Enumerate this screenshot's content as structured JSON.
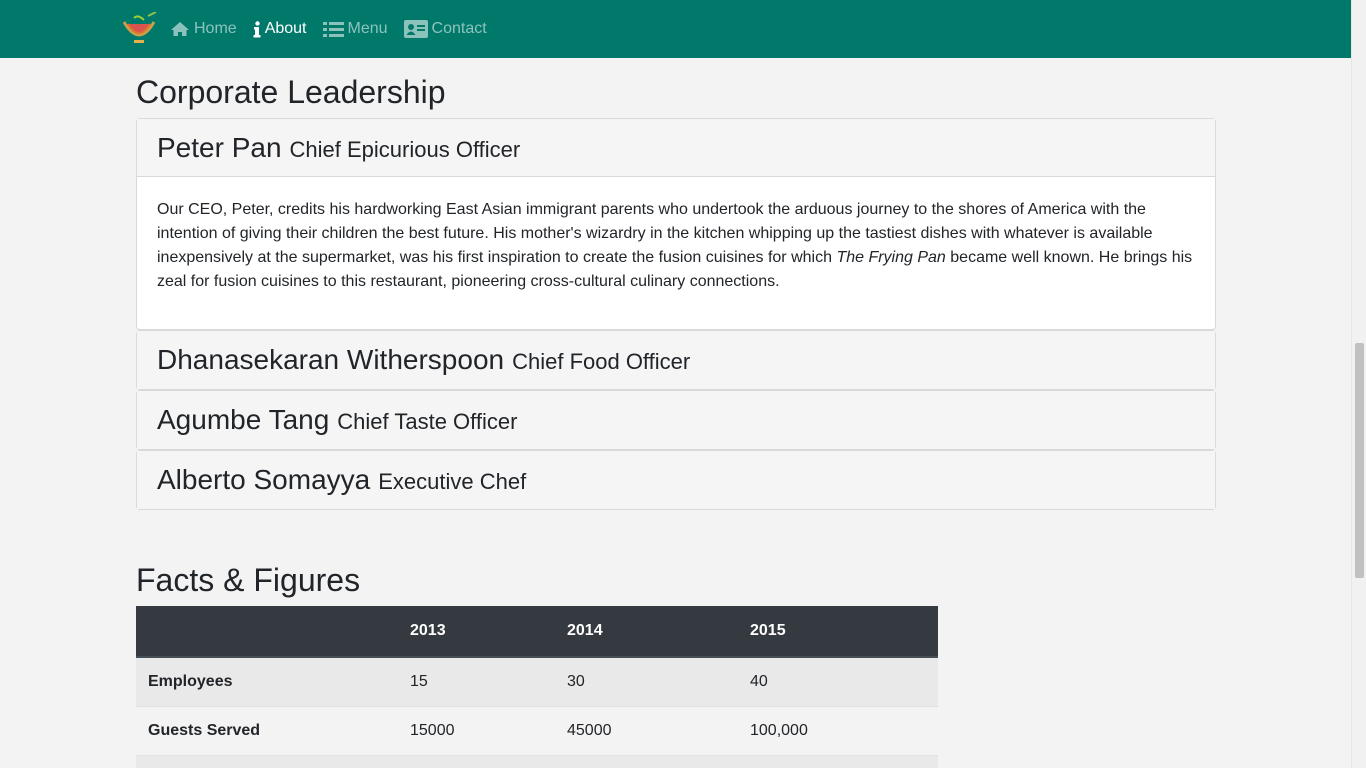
{
  "nav": {
    "items": [
      {
        "label": "Home",
        "icon": "home-icon"
      },
      {
        "label": "About",
        "icon": "info-icon",
        "active": true
      },
      {
        "label": "Menu",
        "icon": "list-icon"
      },
      {
        "label": "Contact",
        "icon": "address-card-icon"
      }
    ],
    "brand_color": "#00796b"
  },
  "leadership": {
    "heading": "Corporate Leadership",
    "people": [
      {
        "name": "Peter Pan",
        "role": "Chief Epicurious Officer",
        "bio_before": "Our CEO, Peter, credits his hardworking East Asian immigrant parents who undertook the arduous journey to the shores of America with the intention of giving their children the best future. His mother's wizardry in the kitchen whipping up the tastiest dishes with whatever is available inexpensively at the supermarket, was his first inspiration to create the fusion cuisines for which ",
        "bio_italic": "The Frying Pan",
        "bio_after": " became well known. He brings his zeal for fusion cuisines to this restaurant, pioneering cross-cultural culinary connections."
      },
      {
        "name": "Dhanasekaran Witherspoon",
        "role": "Chief Food Officer"
      },
      {
        "name": "Agumbe Tang",
        "role": "Chief Taste Officer"
      },
      {
        "name": "Alberto Somayya",
        "role": "Executive Chef"
      }
    ]
  },
  "facts": {
    "heading": "Facts & Figures",
    "columns": [
      "",
      "2013",
      "2014",
      "2015"
    ],
    "rows": [
      [
        "Employees",
        "15",
        "30",
        "40"
      ],
      [
        "Guests Served",
        "15000",
        "45000",
        "100,000"
      ]
    ]
  }
}
